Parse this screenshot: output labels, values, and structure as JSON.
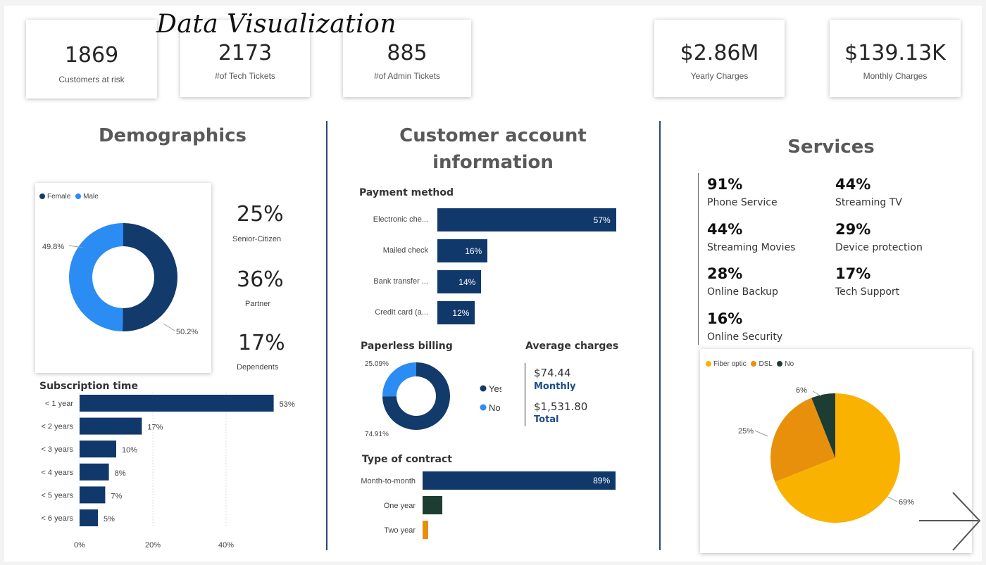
{
  "title": "Data Visualization",
  "kpis": [
    {
      "value": "1869",
      "label": "Customers at risk"
    },
    {
      "value": "2173",
      "label": "#of Tech Tickets"
    },
    {
      "value": "885",
      "label": "#of Admin Tickets"
    },
    {
      "value": "$2.86M",
      "label": "Yearly Charges"
    },
    {
      "value": "$139.13K",
      "label": "Monthly Charges"
    }
  ],
  "demographics": {
    "title": "Demographics",
    "legend": [
      "Female",
      "Male"
    ],
    "donut": {
      "female_pct": 50.2,
      "male_pct": 49.8,
      "female_label": "50.2%",
      "male_label": "49.8%"
    },
    "colors": {
      "female": "#123a6b",
      "male": "#2b8cf3"
    },
    "stats": [
      {
        "value": "25%",
        "label": "Senior-Citizen"
      },
      {
        "value": "36%",
        "label": "Partner"
      },
      {
        "value": "17%",
        "label": "Dependents"
      }
    ],
    "subscription": {
      "title": "Subscription time",
      "rows": [
        {
          "label": "< 1 year",
          "value": 53,
          "text": "53%"
        },
        {
          "label": "< 2 years",
          "value": 17,
          "text": "17%"
        },
        {
          "label": "< 3 years",
          "value": 10,
          "text": "10%"
        },
        {
          "label": "< 4 years",
          "value": 8,
          "text": "8%"
        },
        {
          "label": "< 5 years",
          "value": 7,
          "text": "7%"
        },
        {
          "label": "< 6 years",
          "value": 5,
          "text": "5%"
        }
      ],
      "axis": [
        "0%",
        "20%",
        "40%"
      ]
    }
  },
  "account": {
    "title_line1": "Customer account",
    "title_line2": "information",
    "payment": {
      "title": "Payment method",
      "rows": [
        {
          "label": "Electronic che...",
          "value": 57,
          "text": "57%"
        },
        {
          "label": "Mailed check",
          "value": 16,
          "text": "16%"
        },
        {
          "label": "Bank transfer ...",
          "value": 14,
          "text": "14%"
        },
        {
          "label": "Credit card (a...",
          "value": 12,
          "text": "12%"
        }
      ]
    },
    "paperless": {
      "title": "Paperless billing",
      "yes_pct": 74.91,
      "no_pct": 25.09,
      "yes_text": "74.91%",
      "no_text": "25.09%",
      "legend_yes": "Yes",
      "legend_no": "No",
      "colors": {
        "yes": "#123a6b",
        "no": "#2b8cf3"
      }
    },
    "average": {
      "title": "Average charges",
      "monthly_value": "$74.44",
      "monthly_label": "Monthly",
      "total_value": "$1,531.80",
      "total_label": "Total"
    },
    "contract": {
      "title": "Type of contract",
      "rows": [
        {
          "label": "Month-to-month",
          "value": 89,
          "text": "89%",
          "color": "#11386b"
        },
        {
          "label": "One year",
          "value": 9,
          "text": "",
          "color": "#1d3d33"
        },
        {
          "label": "Two year",
          "value": 2,
          "text": "",
          "color": "#e8900c"
        }
      ]
    }
  },
  "services": {
    "title": "Services",
    "items": [
      {
        "pct": "91%",
        "label": "Phone Service"
      },
      {
        "pct": "44%",
        "label": "Streaming TV"
      },
      {
        "pct": "44%",
        "label": "Streaming Movies"
      },
      {
        "pct": "29%",
        "label": "Device protection"
      },
      {
        "pct": "28%",
        "label": "Online Backup"
      },
      {
        "pct": "17%",
        "label": "Tech Support"
      },
      {
        "pct": "16%",
        "label": "Online Security"
      }
    ],
    "internet_pie": {
      "legend": [
        "Fiber optic",
        "DSL",
        "No"
      ],
      "values": [
        69,
        25,
        6
      ],
      "labels": [
        "69%",
        "25%",
        "6%"
      ],
      "colors": [
        "#f9b200",
        "#e8900c",
        "#1d3d33"
      ]
    }
  }
}
